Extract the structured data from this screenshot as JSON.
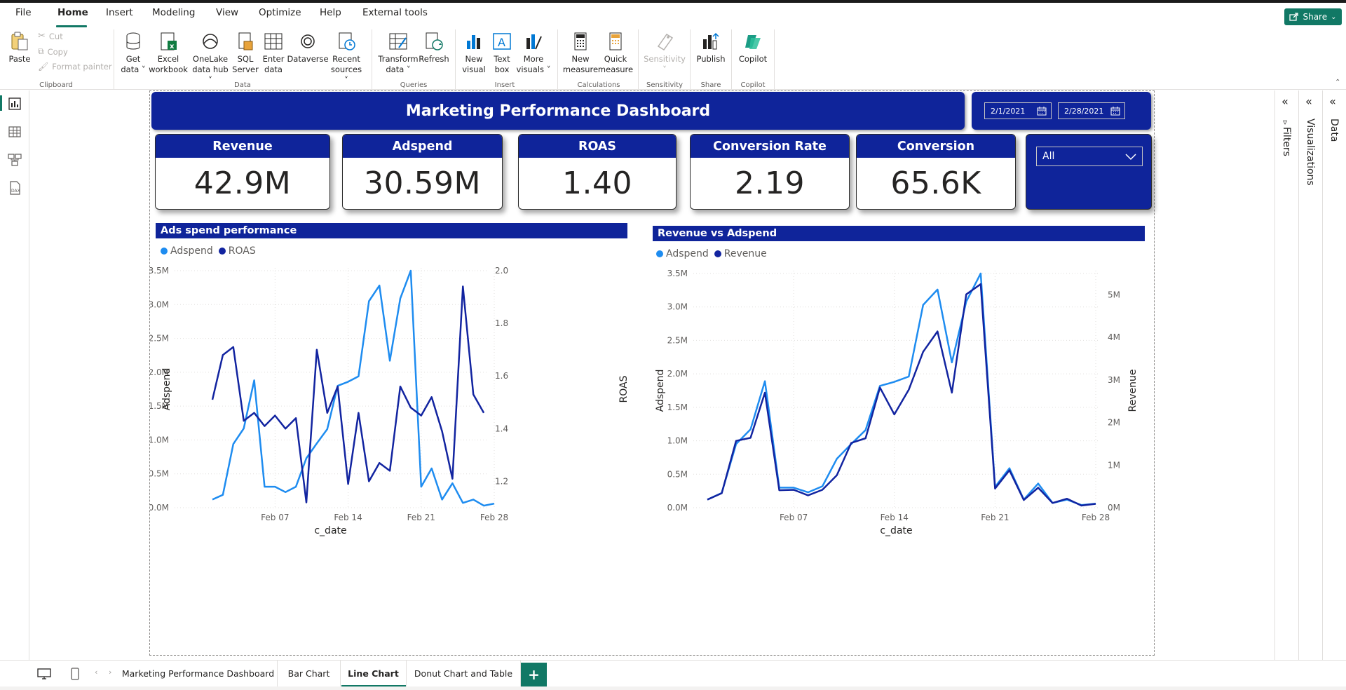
{
  "menu": {
    "items": [
      "File",
      "Home",
      "Insert",
      "Modeling",
      "View",
      "Optimize",
      "Help",
      "External tools"
    ],
    "active": "Home",
    "share_label": "Share"
  },
  "ribbon": {
    "clipboard": {
      "paste": "Paste",
      "cut": "Cut",
      "copy": "Copy",
      "format_painter": "Format painter",
      "group": "Clipboard"
    },
    "data": {
      "get_data_1": "Get",
      "get_data_2": "data ˅",
      "excel_1": "Excel",
      "excel_2": "workbook",
      "onelake_1": "OneLake",
      "onelake_2": "data hub ˅",
      "sql_1": "SQL",
      "sql_2": "Server",
      "enter_1": "Enter",
      "enter_2": "data",
      "dataverse": "Dataverse",
      "recent_1": "Recent",
      "recent_2": "sources ˅",
      "group": "Data"
    },
    "queries": {
      "transform_1": "Transform",
      "transform_2": "data ˅",
      "refresh": "Refresh",
      "group": "Queries"
    },
    "insert": {
      "new_visual_1": "New",
      "new_visual_2": "visual",
      "text_box_1": "Text",
      "text_box_2": "box",
      "more_visuals_1": "More",
      "more_visuals_2": "visuals ˅",
      "group": "Insert"
    },
    "calculations": {
      "new_measure_1": "New",
      "new_measure_2": "measure",
      "quick_measure_1": "Quick",
      "quick_measure_2": "measure",
      "group": "Calculations"
    },
    "sensitivity": {
      "label": "Sensitivity",
      "caret": "˅",
      "group": "Sensitivity"
    },
    "share": {
      "publish": "Publish",
      "group": "Share"
    },
    "copilot": {
      "label": "Copilot",
      "group": "Copilot"
    }
  },
  "report": {
    "title": "Marketing Performance Dashboard",
    "date_start": "2/1/2021",
    "date_end": "2/28/2021",
    "slicer_value": "All",
    "kpis": [
      {
        "label": "Revenue",
        "value": "42.9M"
      },
      {
        "label": "Adspend",
        "value": "30.59M"
      },
      {
        "label": "ROAS",
        "value": "1.40"
      },
      {
        "label": "Conversion Rate",
        "value": "2.19"
      },
      {
        "label": "Conversion",
        "value": "65.6K"
      }
    ]
  },
  "panes": {
    "filters": "Filters",
    "visualizations": "Visualizations",
    "data": "Data"
  },
  "tabs": {
    "items": [
      "Marketing Performance Dashboard",
      "Bar Chart",
      "Line Chart",
      "Donut Chart and Table"
    ],
    "active": "Line Chart",
    "add": "+"
  },
  "colors": {
    "brand_navy": "#0f249a",
    "adspend_line": "#1e8cf0",
    "second_line": "#1224a0",
    "accent_green": "#117865"
  },
  "chart_data": [
    {
      "type": "line",
      "title": "Ads spend performance",
      "xlabel": "c_date",
      "ylabel": "Adspend",
      "y2label": "ROAS",
      "x": [
        "Feb 01",
        "Feb 02",
        "Feb 03",
        "Feb 04",
        "Feb 05",
        "Feb 06",
        "Feb 07",
        "Feb 08",
        "Feb 09",
        "Feb 10",
        "Feb 11",
        "Feb 12",
        "Feb 13",
        "Feb 14",
        "Feb 15",
        "Feb 16",
        "Feb 17",
        "Feb 18",
        "Feb 19",
        "Feb 20",
        "Feb 21",
        "Feb 22",
        "Feb 23",
        "Feb 24",
        "Feb 25",
        "Feb 26",
        "Feb 27",
        "Feb 28"
      ],
      "xticks": [
        "Feb 07",
        "Feb 14",
        "Feb 21",
        "Feb 28"
      ],
      "ylim": [
        0,
        3500000
      ],
      "yticks": [
        "0.0M",
        "0.5M",
        "1.0M",
        "1.5M",
        "2.0M",
        "2.5M",
        "3.0M",
        "3.5M"
      ],
      "y2lim": [
        1.1,
        2.0
      ],
      "y2ticks": [
        "1.2",
        "1.4",
        "1.6",
        "1.8",
        "2.0"
      ],
      "legend_position": "top-left",
      "grid": true,
      "series": [
        {
          "name": "Adspend",
          "axis": "left",
          "color": "#1e8cf0",
          "values": [
            120000,
            190000,
            940000,
            1170000,
            1880000,
            310000,
            310000,
            230000,
            310000,
            730000,
            950000,
            1160000,
            1800000,
            1860000,
            1940000,
            3050000,
            3280000,
            2170000,
            3090000,
            3500000,
            310000,
            580000,
            120000,
            360000,
            70000,
            120000,
            30000,
            60000
          ]
        },
        {
          "name": "ROAS",
          "axis": "right",
          "color": "#1224a0",
          "values": [
            1.51,
            1.68,
            1.71,
            1.43,
            1.46,
            1.41,
            1.45,
            1.4,
            1.44,
            1.12,
            1.7,
            1.46,
            1.56,
            1.19,
            1.46,
            1.2,
            1.27,
            1.24,
            1.56,
            1.48,
            1.45,
            1.52,
            1.39,
            1.21,
            1.94,
            1.53,
            1.46
          ]
        }
      ]
    },
    {
      "type": "line",
      "title": "Revenue vs Adspend",
      "xlabel": "c_date",
      "ylabel": "Adspend",
      "y2label": "Revenue",
      "x": [
        "Feb 01",
        "Feb 02",
        "Feb 03",
        "Feb 04",
        "Feb 05",
        "Feb 06",
        "Feb 07",
        "Feb 08",
        "Feb 09",
        "Feb 10",
        "Feb 11",
        "Feb 12",
        "Feb 13",
        "Feb 14",
        "Feb 15",
        "Feb 16",
        "Feb 17",
        "Feb 18",
        "Feb 19",
        "Feb 20",
        "Feb 21",
        "Feb 22",
        "Feb 23",
        "Feb 24",
        "Feb 25",
        "Feb 26",
        "Feb 27",
        "Feb 28"
      ],
      "xticks": [
        "Feb 07",
        "Feb 14",
        "Feb 21",
        "Feb 28"
      ],
      "ylim": [
        0,
        3500000
      ],
      "yticks": [
        "0.0M",
        "0.5M",
        "1.0M",
        "1.5M",
        "2.0M",
        "2.5M",
        "3.0M",
        "3.5M"
      ],
      "y2lim": [
        0,
        5500000
      ],
      "y2ticks": [
        "0M",
        "1M",
        "2M",
        "3M",
        "4M",
        "5M"
      ],
      "legend_position": "top-left",
      "grid": true,
      "series": [
        {
          "name": "Adspend",
          "axis": "left",
          "color": "#1e8cf0",
          "values": [
            120000,
            220000,
            950000,
            1170000,
            1890000,
            300000,
            300000,
            230000,
            320000,
            730000,
            950000,
            1160000,
            1820000,
            1880000,
            1960000,
            3030000,
            3260000,
            2170000,
            3080000,
            3500000,
            310000,
            590000,
            120000,
            360000,
            70000,
            120000,
            40000,
            60000
          ]
        },
        {
          "name": "Revenue",
          "axis": "right",
          "color": "#1224a0",
          "values": [
            190000,
            340000,
            1570000,
            1640000,
            2700000,
            410000,
            420000,
            290000,
            420000,
            760000,
            1520000,
            1630000,
            2820000,
            2190000,
            2770000,
            3660000,
            4140000,
            2700000,
            5010000,
            5250000,
            450000,
            880000,
            180000,
            470000,
            110000,
            210000,
            50000,
            90000
          ]
        }
      ]
    }
  ]
}
